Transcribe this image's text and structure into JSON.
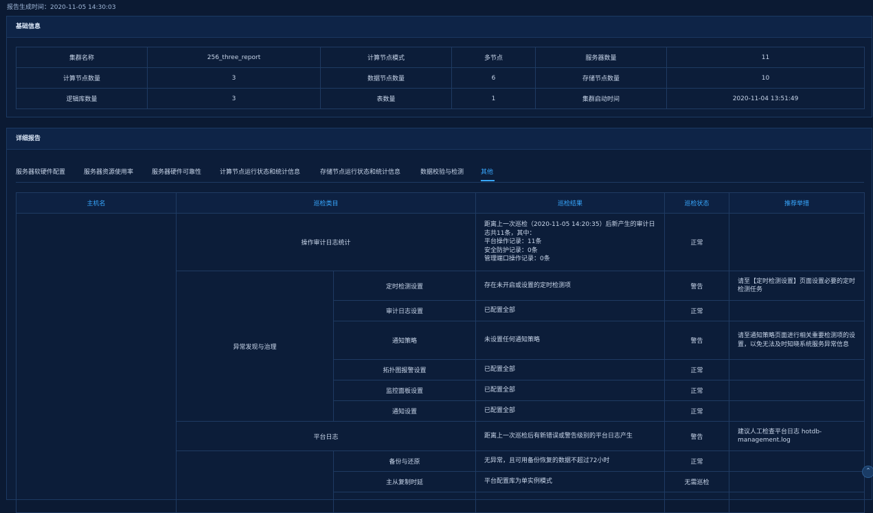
{
  "report_time": "报告生成时间：2020-11-05 14:30:03",
  "basic": {
    "title": "基础信息",
    "rows": [
      [
        "集群名称",
        "256_three_report",
        "计算节点模式",
        "多节点",
        "服务器数量",
        "11"
      ],
      [
        "计算节点数量",
        "3",
        "数据节点数量",
        "6",
        "存储节点数量",
        "10"
      ],
      [
        "逻辑库数量",
        "3",
        "表数量",
        "1",
        "集群启动时间",
        "2020-11-04 13:51:49"
      ]
    ]
  },
  "detail": {
    "title": "详细报告",
    "tabs": [
      "服务器软硬件配置",
      "服务器资源使用率",
      "服务器硬件可靠性",
      "计算节点运行状态和统计信息",
      "存储节点运行状态和统计信息",
      "数据校验与检测",
      "其他"
    ],
    "active_tab": 6,
    "headers": [
      "主机名",
      "巡检类目",
      "巡检结果",
      "巡检状态",
      "推荐举措"
    ],
    "rows": {
      "audit": {
        "category": "操作审计日志统计",
        "result": "距离上一次巡检（2020-11-05 14:20:35）后新产生的审计日志共11条，其中：\n平台操作记录：11条\n安全防护记录：0条\n管理端口操作记录：0条",
        "status": "正常"
      },
      "anomaly_group": "异常发现与治理",
      "anomaly": [
        {
          "item": "定时检测设置",
          "result": "存在未开启或设置的定时检测项",
          "status": "警告",
          "advice": "请至【定时检测设置】页面设置必要的定时检测任务"
        },
        {
          "item": "审计日志设置",
          "result": "已配置全部",
          "status": "正常",
          "advice": ""
        },
        {
          "item": "通知策略",
          "result": "未设置任何通知策略",
          "status": "警告",
          "advice": "请至通知策略页面进行相关重要检测项的设置，以免无法及时知晓系统服务异常信息"
        },
        {
          "item": "拓扑图报警设置",
          "result": "已配置全部",
          "status": "正常",
          "advice": ""
        },
        {
          "item": "监控面板设置",
          "result": "已配置全部",
          "status": "正常",
          "advice": ""
        },
        {
          "item": "通知设置",
          "result": "已配置全部",
          "status": "正常",
          "advice": ""
        }
      ],
      "platform_log": {
        "category": "平台日志",
        "result": "距离上一次巡检后有新错误或警告级别的平台日志产生",
        "status": "警告",
        "advice": "建议人工检查平台日志 hotdb-management.log"
      },
      "last_group": [
        {
          "item": "备份与还原",
          "result": "无异常，且可用备份恢复的数据不超过72小时",
          "status": "正常",
          "advice": ""
        },
        {
          "item": "主从复制时延",
          "result": "平台配置库为单实例模式",
          "status": "无需巡检",
          "advice": ""
        }
      ]
    }
  },
  "colors": {
    "ok": "#27c45a",
    "warn": "#e0a94a",
    "accent": "#38a8ff"
  }
}
